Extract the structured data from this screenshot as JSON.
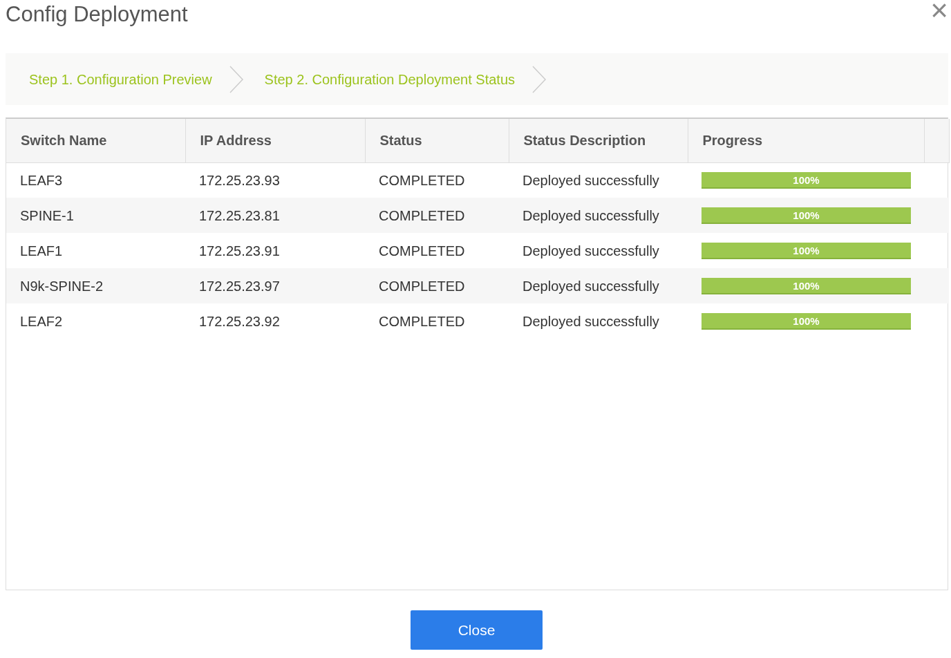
{
  "dialog": {
    "title": "Config Deployment",
    "close_icon": "×"
  },
  "steps": [
    "Step 1. Configuration Preview",
    "Step 2. Configuration Deployment Status"
  ],
  "table": {
    "columns": [
      "Switch Name",
      "IP Address",
      "Status",
      "Status Description",
      "Progress"
    ],
    "rows": [
      {
        "switch_name": "LEAF3",
        "ip_address": "172.25.23.93",
        "status": "COMPLETED",
        "status_description": "Deployed successfully",
        "progress": {
          "level": 1,
          "label": "100%"
        }
      },
      {
        "switch_name": "SPINE-1",
        "ip_address": "172.25.23.81",
        "status": "COMPLETED",
        "status_description": "Deployed successfully",
        "progress": {
          "level": 1,
          "label": "100%"
        }
      },
      {
        "switch_name": "LEAF1",
        "ip_address": "172.25.23.91",
        "status": "COMPLETED",
        "status_description": "Deployed successfully",
        "progress": {
          "level": 1,
          "label": "100%"
        }
      },
      {
        "switch_name": "N9k-SPINE-2",
        "ip_address": "172.25.23.97",
        "status": "COMPLETED",
        "status_description": "Deployed successfully",
        "progress": {
          "level": 1,
          "label": "100%"
        }
      },
      {
        "switch_name": "LEAF2",
        "ip_address": "172.25.23.92",
        "status": "COMPLETED",
        "status_description": "Deployed successfully",
        "progress": {
          "level": 1,
          "label": "100%"
        }
      }
    ]
  },
  "buttons": [
    "Close"
  ]
}
